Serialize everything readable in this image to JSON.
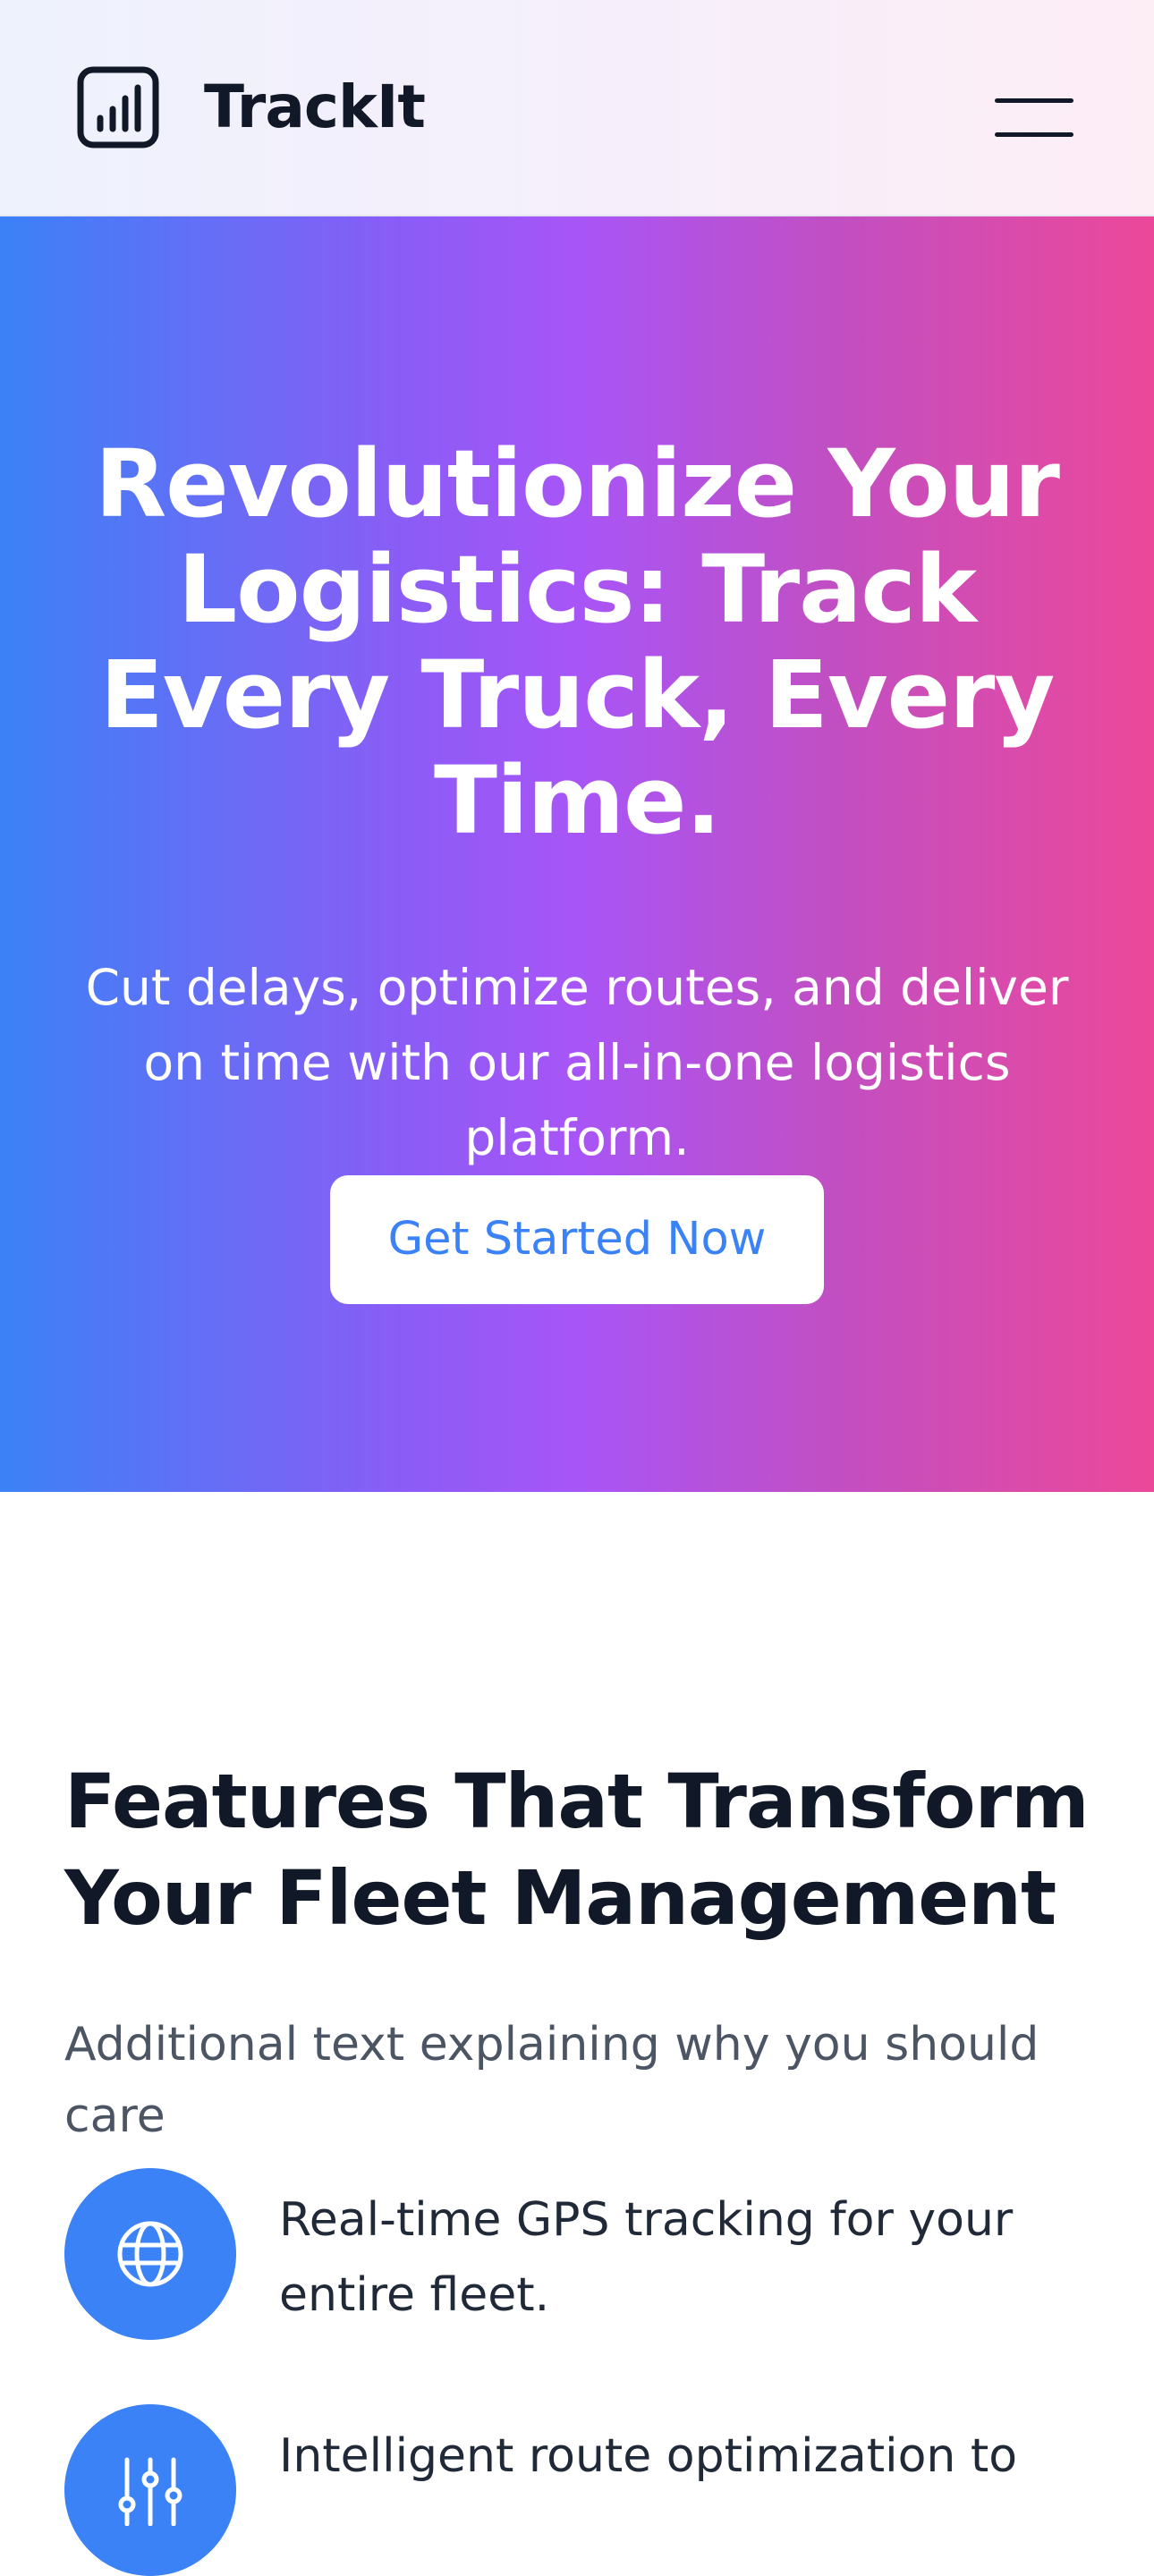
{
  "header": {
    "brand": "TrackIt",
    "logo_icon": "bar-chart-icon",
    "menu_icon": "hamburger-menu-icon"
  },
  "hero": {
    "title": "Revolutionize Your Logistics: Track Every Truck, Every Time.",
    "subtitle": "Cut delays, optimize routes, and deliver on time with our all-in-one logistics platform.",
    "cta_label": "Get Started Now"
  },
  "features": {
    "title": "Features That Transform Your Fleet Management",
    "subtitle": "Additional text explaining why you should care",
    "items": [
      {
        "icon": "globe-icon",
        "text": "Real-time GPS tracking for your entire fleet."
      },
      {
        "icon": "sliders-icon",
        "text": "Intelligent route optimization to"
      }
    ]
  },
  "colors": {
    "accent": "#3b82f6",
    "gradient_start": "#3b82f6",
    "gradient_mid": "#a855f7",
    "gradient_end": "#ec4899",
    "text_dark": "#111827",
    "text_muted": "#4b5563"
  }
}
